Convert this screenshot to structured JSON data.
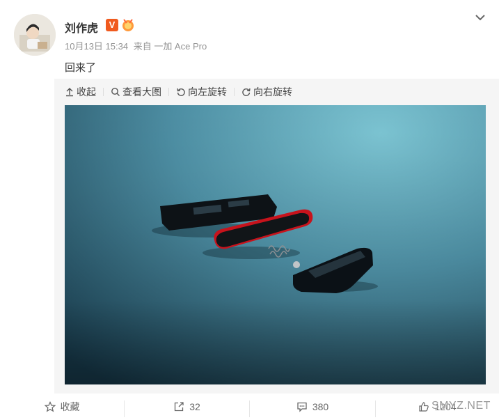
{
  "author": {
    "name": "刘作虎",
    "badge": "V"
  },
  "meta": {
    "time": "10月13日 15:34",
    "source": "来自 一加 Ace Pro"
  },
  "post": {
    "text": "回来了"
  },
  "toolbar": {
    "collapse": "收起",
    "view_large": "查看大图",
    "rotate_left": "向左旋转",
    "rotate_right": "向右旋转"
  },
  "actions": {
    "favorite": "收藏",
    "repost_count": "32",
    "comment_count": "380",
    "like_count": "1204"
  },
  "watermark": "SMYZ.NET",
  "colors": {
    "badge": "#f05a1e",
    "text_secondary": "#939393",
    "media_bg": "#f5f5f5"
  }
}
